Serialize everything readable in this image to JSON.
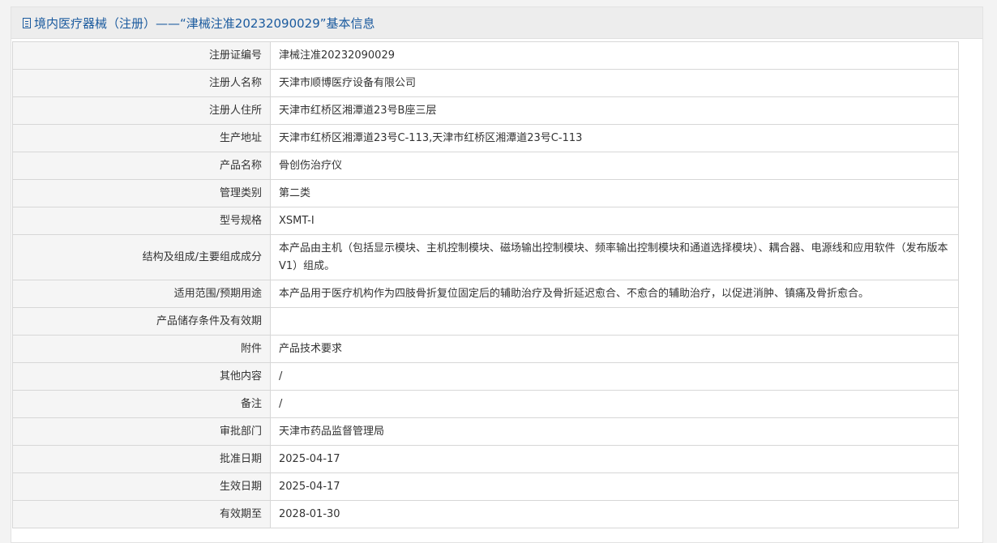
{
  "header": {
    "title": "境内医疗器械（注册）——“津械注准20232090029”基本信息"
  },
  "rows": [
    {
      "label": "注册证编号",
      "value": "津械注准20232090029"
    },
    {
      "label": "注册人名称",
      "value": "天津市顺博医疗设备有限公司"
    },
    {
      "label": "注册人住所",
      "value": "天津市红桥区湘潭道23号B座三层"
    },
    {
      "label": "生产地址",
      "value": "天津市红桥区湘潭道23号C-113,天津市红桥区湘潭道23号C-113"
    },
    {
      "label": "产品名称",
      "value": "骨创伤治疗仪"
    },
    {
      "label": "管理类别",
      "value": "第二类"
    },
    {
      "label": "型号规格",
      "value": "XSMT-I"
    },
    {
      "label": "结构及组成/主要组成成分",
      "value": "本产品由主机（包括显示模块、主机控制模块、磁场输出控制模块、频率输出控制模块和通道选择模块）、耦合器、电源线和应用软件（发布版本V1）组成。"
    },
    {
      "label": "适用范围/预期用途",
      "value": "本产品用于医疗机构作为四肢骨折复位固定后的辅助治疗及骨折延迟愈合、不愈合的辅助治疗，以促进消肿、镇痛及骨折愈合。"
    },
    {
      "label": "产品储存条件及有效期",
      "value": ""
    },
    {
      "label": "附件",
      "value": "产品技术要求"
    },
    {
      "label": "其他内容",
      "value": "/"
    },
    {
      "label": "备注",
      "value": "/"
    },
    {
      "label": "审批部门",
      "value": "天津市药品监督管理局"
    },
    {
      "label": "批准日期",
      "value": "2025-04-17"
    },
    {
      "label": "生效日期",
      "value": "2025-04-17"
    },
    {
      "label": "有效期至",
      "value": "2028-01-30"
    }
  ]
}
